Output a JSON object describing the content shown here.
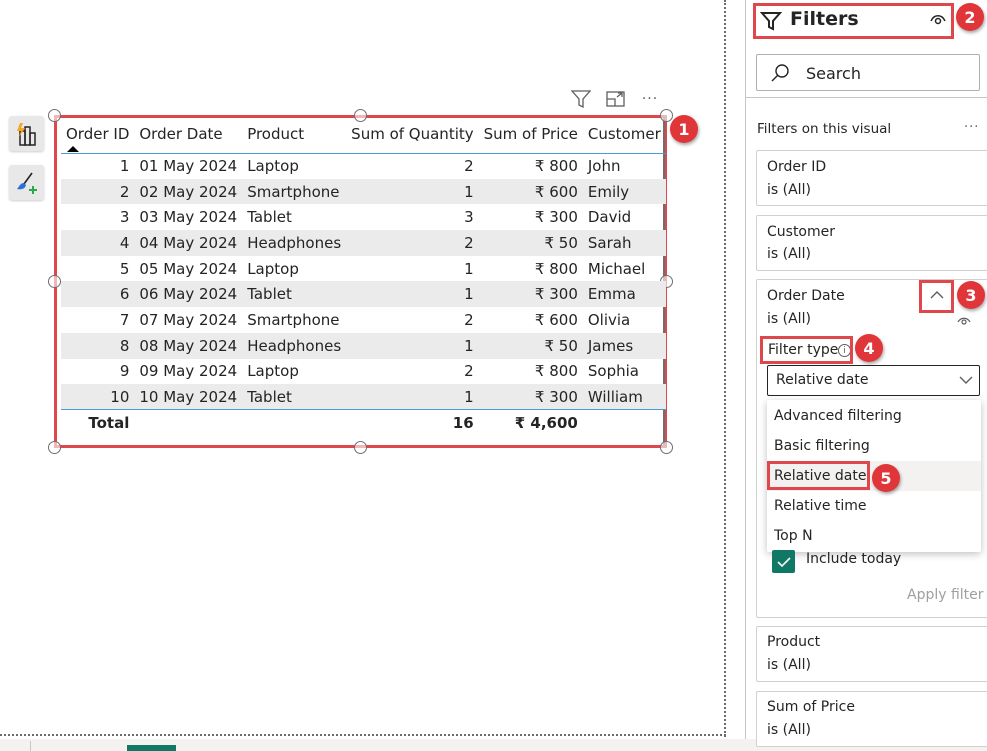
{
  "side_tools": [
    {
      "name": "smart-narrative-visual",
      "icon": "chart-lightning-icon"
    },
    {
      "name": "format-paintbrush",
      "icon": "paintbrush-add-icon"
    }
  ],
  "visual_header": {
    "icons": [
      "filter-icon",
      "focus-mode-icon",
      "more-options-icon"
    ],
    "more_label": "···"
  },
  "table": {
    "columns": [
      "Order ID",
      "Order Date",
      "Product",
      "Sum of Quantity",
      "Sum of Price",
      "Customer"
    ],
    "sorted_column": "Order ID",
    "rows": [
      {
        "id": "1",
        "date": "01 May 2024",
        "product": "Laptop",
        "qty": "2",
        "price": "₹ 800",
        "customer": "John"
      },
      {
        "id": "2",
        "date": "02 May 2024",
        "product": "Smartphone",
        "qty": "1",
        "price": "₹ 600",
        "customer": "Emily"
      },
      {
        "id": "3",
        "date": "03 May 2024",
        "product": "Tablet",
        "qty": "3",
        "price": "₹ 300",
        "customer": "David"
      },
      {
        "id": "4",
        "date": "04 May 2024",
        "product": "Headphones",
        "qty": "2",
        "price": "₹ 50",
        "customer": "Sarah"
      },
      {
        "id": "5",
        "date": "05 May 2024",
        "product": "Laptop",
        "qty": "1",
        "price": "₹ 800",
        "customer": "Michael"
      },
      {
        "id": "6",
        "date": "06 May 2024",
        "product": "Tablet",
        "qty": "1",
        "price": "₹ 300",
        "customer": "Emma"
      },
      {
        "id": "7",
        "date": "07 May 2024",
        "product": "Smartphone",
        "qty": "2",
        "price": "₹ 600",
        "customer": "Olivia"
      },
      {
        "id": "8",
        "date": "08 May 2024",
        "product": "Headphones",
        "qty": "1",
        "price": "₹ 50",
        "customer": "James"
      },
      {
        "id": "9",
        "date": "09 May 2024",
        "product": "Laptop",
        "qty": "2",
        "price": "₹ 800",
        "customer": "Sophia"
      },
      {
        "id": "10",
        "date": "10 May 2024",
        "product": "Tablet",
        "qty": "1",
        "price": "₹ 300",
        "customer": "William"
      }
    ],
    "total": {
      "label": "Total",
      "qty": "16",
      "price": "₹ 4,600"
    }
  },
  "annotations": [
    "1",
    "2",
    "3",
    "4",
    "5"
  ],
  "filters_pane": {
    "title": "Filters",
    "search_placeholder": "Search",
    "section_label": "Filters on this visual",
    "section_more": "···",
    "cards": [
      {
        "name": "Order ID",
        "value": "is (All)"
      },
      {
        "name": "Customer",
        "value": "is (All)"
      },
      {
        "name": "Order Date",
        "value": "is (All)"
      },
      {
        "name": "Product",
        "value": "is (All)"
      },
      {
        "name": "Sum of Price",
        "value": "is (All)"
      }
    ],
    "filter_type_label": "Filter type",
    "filter_type_info": "i",
    "filter_type_selected": "Relative date",
    "filter_type_options": [
      "Advanced filtering",
      "Basic filtering",
      "Relative date",
      "Relative time",
      "Top N"
    ],
    "include_today_label": "Include today",
    "include_today_checked": true,
    "apply_filter_label": "Apply filter"
  },
  "colors": {
    "annotation_red": "#e0474c",
    "accent_teal": "#117865",
    "header_rule": "#4a9dcf"
  }
}
